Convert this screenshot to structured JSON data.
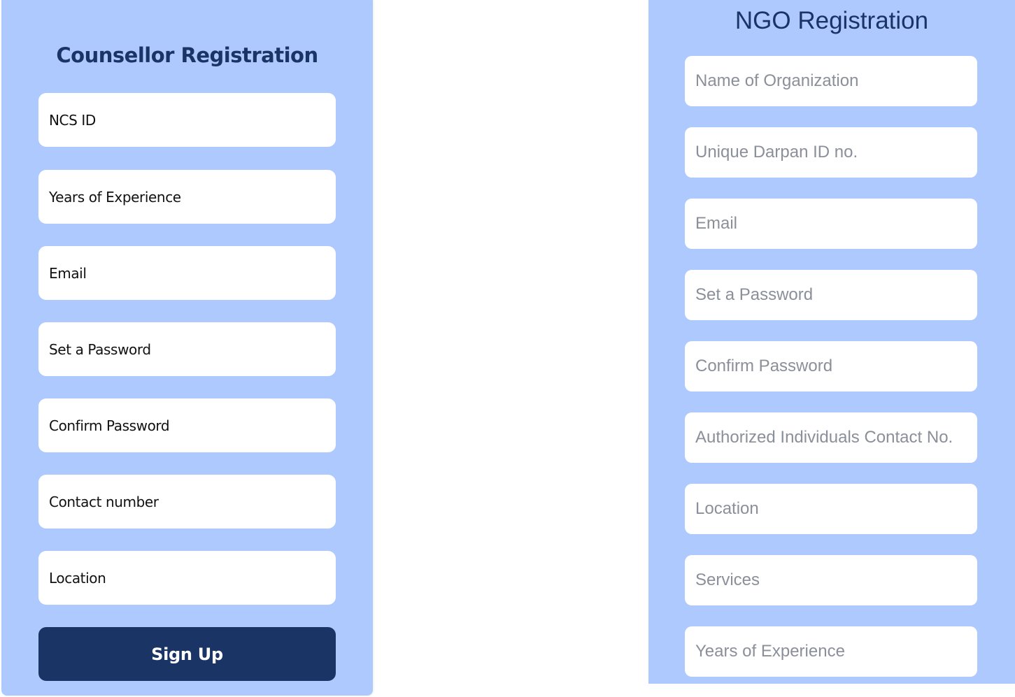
{
  "counsellor": {
    "title": "Counsellor Registration",
    "fields": [
      "NCS ID",
      "Years of Experience",
      "Email",
      "Set a Password",
      "Confirm Password",
      "Contact number",
      "Location"
    ],
    "signup_label": "Sign Up",
    "colors": {
      "panel": "#adc9fd",
      "accent": "#1b3466"
    }
  },
  "ngo": {
    "title": "NGO Registration",
    "fields": [
      "Name of Organization",
      "Unique Darpan ID no.",
      "Email",
      "Set a Password",
      "Confirm Password",
      "Authorized Individuals Contact No.",
      "Location",
      "Services",
      "Years of Experience"
    ]
  }
}
